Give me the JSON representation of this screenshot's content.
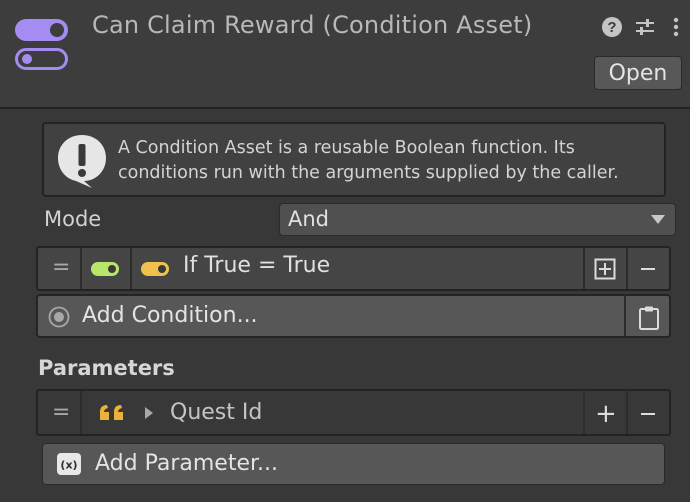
{
  "header": {
    "title": "Can Claim Reward (Condition Asset)",
    "open_label": "Open",
    "icons": [
      "toggle-asset-icon",
      "help-icon",
      "settings-sliders-icon",
      "more-vertical-icon"
    ]
  },
  "help": {
    "text": "A Condition Asset is a reusable Boolean function. Its conditions run with the arguments supplied by the caller."
  },
  "mode": {
    "label": "Mode",
    "value": "And"
  },
  "conditions": [
    {
      "text": "If True = True",
      "enabled": true,
      "toggle_color": "#b7e66a",
      "icon_color": "#f0c24b"
    }
  ],
  "add_condition_label": "Add Condition...",
  "parameters": {
    "title": "Parameters",
    "items": [
      {
        "name": "Quest Id",
        "type_icon": "string-quote-icon"
      }
    ],
    "add_label": "Add Parameter..."
  },
  "colors": {
    "accent_purple": "#a58cf2",
    "condition_toggle": "#b7e66a",
    "condition_icon": "#f0c24b",
    "string_type": "#eab23b"
  }
}
